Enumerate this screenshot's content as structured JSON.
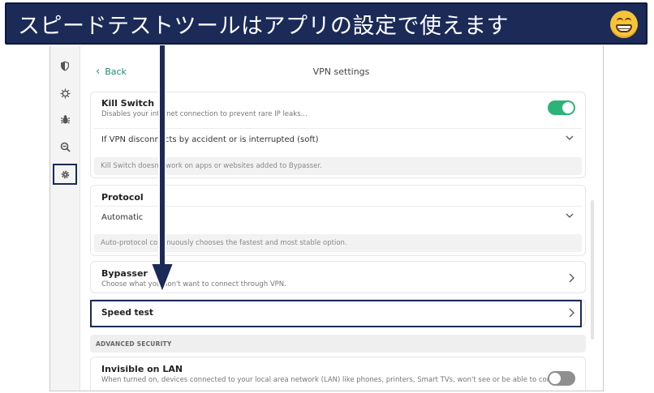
{
  "banner": {
    "text": "スピードテストツールはアプリの設定で使えます",
    "emoji_icon": "grinning-face-icon"
  },
  "app": {
    "page_title": "VPN settings",
    "back_label": "Back",
    "rail_icons": [
      "shield-icon",
      "virus-scan-icon",
      "bug-icon",
      "search-minus-icon",
      "gear-icon"
    ],
    "kill_switch": {
      "title": "Kill Switch",
      "desc": "Disables your internet connection to prevent rare IP leaks...",
      "toggle": "on",
      "dropdown_value": "If VPN disconnects by accident or is interrupted (soft)",
      "note": "Kill Switch doesn't work on apps or websites added to Bypasser."
    },
    "protocol": {
      "title": "Protocol",
      "value": "Automatic",
      "note": "Auto-protocol continuously chooses the fastest and most stable option."
    },
    "bypasser": {
      "title": "Bypasser",
      "desc": "Choose what you don't want to connect through VPN."
    },
    "speed_test": {
      "title": "Speed test"
    },
    "advanced_security": {
      "label": "ADVANCED SECURITY"
    },
    "invisible_lan": {
      "title": "Invisible on LAN",
      "desc": "When turned on, devices connected to your local area network (LAN) like phones, printers, Smart TVs, won't see or be able to connect to",
      "toggle": "off"
    }
  },
  "colors": {
    "banner_bg": "#1b2a57",
    "accent_green": "#2cb37a",
    "link_green": "#1e8c6f"
  }
}
